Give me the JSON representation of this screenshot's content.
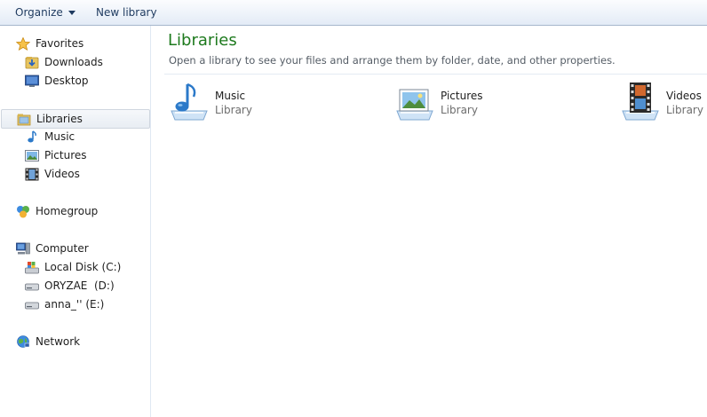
{
  "toolbar": {
    "organize_label": "Organize",
    "new_library_label": "New library"
  },
  "nav": {
    "favorites": {
      "label": "Favorites",
      "items": [
        {
          "label": "Downloads",
          "icon": "downloads-icon"
        },
        {
          "label": "Desktop",
          "icon": "desktop-icon"
        }
      ]
    },
    "libraries": {
      "label": "Libraries",
      "items": [
        {
          "label": "Music",
          "icon": "music-icon"
        },
        {
          "label": "Pictures",
          "icon": "pictures-icon"
        },
        {
          "label": "Videos",
          "icon": "videos-icon"
        }
      ]
    },
    "homegroup": {
      "label": "Homegroup"
    },
    "computer": {
      "label": "Computer",
      "items": [
        {
          "label": "Local Disk (C:)",
          "icon": "local-disk-icon"
        },
        {
          "label": "ORYZAE  (D:)",
          "icon": "drive-icon"
        },
        {
          "label": "anna_'' (E:)",
          "icon": "drive-icon"
        }
      ]
    },
    "network": {
      "label": "Network"
    }
  },
  "main": {
    "title": "Libraries",
    "subtitle": "Open a library to see your files and arrange them by folder, date, and other properties.",
    "libraries": [
      {
        "name": "Music",
        "type": "Library",
        "icon": "music-library-icon"
      },
      {
        "name": "Pictures",
        "type": "Library",
        "icon": "pictures-library-icon"
      },
      {
        "name": "Videos",
        "type": "Library",
        "icon": "videos-library-icon"
      }
    ]
  },
  "colors": {
    "title_green": "#1e7a1e",
    "toolbar_text": "#1e3a5f",
    "selection_border": "#cfd6df"
  }
}
